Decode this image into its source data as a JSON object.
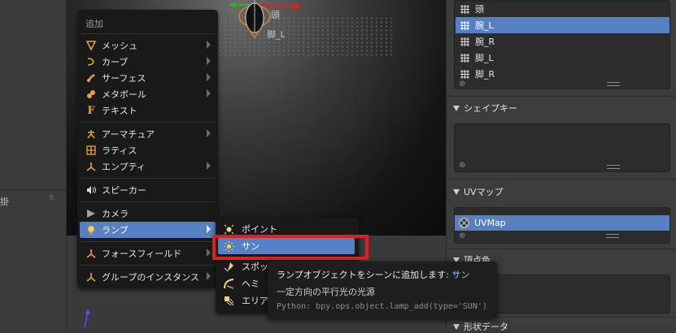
{
  "left_panel": {
    "label": "掛"
  },
  "add_menu": {
    "title": "追加",
    "items": [
      {
        "label": "メッシュ",
        "icon": "mesh-icon",
        "submenu": true
      },
      {
        "label": "カーブ",
        "icon": "curve-icon",
        "submenu": true
      },
      {
        "label": "サーフェス",
        "icon": "surface-icon",
        "submenu": true
      },
      {
        "label": "メタボール",
        "icon": "metaball-icon",
        "submenu": true
      },
      {
        "label": "テキスト",
        "icon": "text-icon",
        "submenu": false
      },
      {
        "label": "アーマチュア",
        "icon": "armature-icon",
        "submenu": true
      },
      {
        "label": "ラティス",
        "icon": "lattice-icon",
        "submenu": false
      },
      {
        "label": "エンプティ",
        "icon": "empty-icon",
        "submenu": true
      },
      {
        "label": "スピーカー",
        "icon": "speaker-icon",
        "submenu": false
      },
      {
        "label": "カメラ",
        "icon": "camera-icon",
        "submenu": false
      },
      {
        "label": "ランプ",
        "icon": "lamp-icon",
        "submenu": true,
        "active": true
      },
      {
        "label": "フォースフィールド",
        "icon": "forcefield-icon",
        "submenu": true
      },
      {
        "label": "グループのインスタンス",
        "icon": "group-instance-icon",
        "submenu": true
      }
    ]
  },
  "lamp_submenu": {
    "items": [
      {
        "label": "ポイント",
        "icon": "point-lamp-icon"
      },
      {
        "label": "サン",
        "icon": "sun-lamp-icon",
        "active": true
      },
      {
        "label": "スポット",
        "icon": "spot-lamp-icon"
      },
      {
        "label": "ヘミ",
        "icon": "hemi-lamp-icon"
      },
      {
        "label": "エリア",
        "icon": "area-lamp-icon"
      }
    ]
  },
  "tooltip": {
    "line1": "ランプオブジェクトをシーンに追加します:",
    "line1_selected": "サン",
    "line2": "一定方向の平行光の光源",
    "python": "Python: bpy.ops.object.lamp_add(type='SUN')"
  },
  "vertex_groups": {
    "items": [
      {
        "label": "頭",
        "selected": false
      },
      {
        "label": "腕_L",
        "selected": true
      },
      {
        "label": "腕_R",
        "selected": false
      },
      {
        "label": "脚_L",
        "selected": false
      },
      {
        "label": "脚_R",
        "selected": false
      }
    ]
  },
  "viewport": {
    "bone_label_1": "頭",
    "bone_label_2": "脚_L"
  },
  "shape_keys": {
    "title": "シェイプキー"
  },
  "uv_maps": {
    "title": "UVマップ",
    "items": [
      {
        "label": "UVMap"
      }
    ]
  },
  "vertex_colors": {
    "title": "頂点色"
  },
  "geometry_data": {
    "title": "形状データ"
  },
  "colors": {
    "accent": "#5680c2",
    "highlight": "#e02020",
    "menu_bg": "#191919"
  }
}
